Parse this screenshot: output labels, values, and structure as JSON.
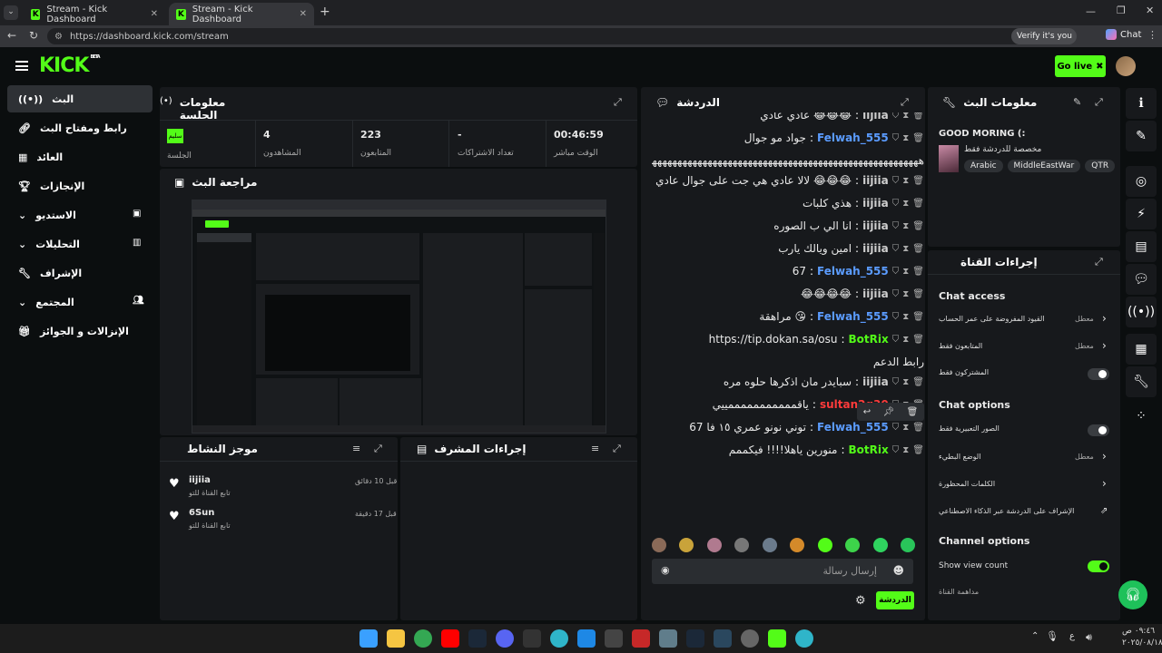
{
  "browser": {
    "tabs": [
      {
        "title": "Stream - Kick Dashboard"
      },
      {
        "title": "Stream - Kick Dashboard"
      }
    ],
    "url": "https://dashboard.kick.com/stream",
    "verify_label": "Verify it's you",
    "chat_label": "Chat"
  },
  "header": {
    "logo": "KICK",
    "logo_sup": "BETA",
    "go_live": "Go live"
  },
  "sidebar": {
    "items": [
      {
        "label": "البث"
      },
      {
        "label": "رابط ومفتاح البث"
      },
      {
        "label": "العائد"
      },
      {
        "label": "الإنجازات"
      },
      {
        "label": "الاستديو"
      },
      {
        "label": "التحليلات"
      },
      {
        "label": "الإشراف"
      },
      {
        "label": "المجتمع"
      },
      {
        "label": "الإنزالات و الجوائز"
      }
    ]
  },
  "session": {
    "title": "معلومات الجلسة",
    "live_badge": "(•)",
    "stats": [
      {
        "value": "00:46:59",
        "label": "الوقت مباشر"
      },
      {
        "value": "-",
        "label": "تعداد الاشتراكات"
      },
      {
        "value": "223",
        "label": "المتابعون"
      },
      {
        "value": "4",
        "label": "المشاهدون"
      }
    ],
    "session_badge": "سليم",
    "session_label": "الجلسة"
  },
  "preview": {
    "title": "مراجعة البث"
  },
  "activity": {
    "title": "موجز النشاط",
    "items": [
      {
        "user": "iijiia",
        "text": "تابع القناة للتو",
        "time": "قبل 10 دقائق"
      },
      {
        "user": "6Sun",
        "text": "تابع القناة للتو",
        "time": "قبل 17 دقيقة"
      }
    ]
  },
  "mod_actions": {
    "title": "إجراءات المشرف"
  },
  "chat": {
    "title": "الدردشة",
    "messages": [
      {
        "user": "iijiia",
        "text": "عادي عادي 😂😂😂",
        "color": "#cfcfcf"
      },
      {
        "user": "Felwah_555",
        "text": "جواد مو جوال",
        "color": "#5b9cff"
      },
      {
        "user": "",
        "text": "ههههههههههههههههههههههههههههههههههههههههههههههههههههههههه",
        "color": "#cfcfcf"
      },
      {
        "user": "iijiia",
        "text": "لالا عادي هي جت على جوال عادي احمد ربي 😂😂😂",
        "color": "#cfcfcf"
      },
      {
        "user": "iijiia",
        "text": "هذي كلبات",
        "color": "#cfcfcf"
      },
      {
        "user": "iijiia",
        "text": "انا الي ب الصوره",
        "color": "#cfcfcf"
      },
      {
        "user": "iijiia",
        "text": "امين ويالك يارب",
        "color": "#cfcfcf"
      },
      {
        "user": "Felwah_555",
        "text": "67",
        "color": "#5b9cff"
      },
      {
        "user": "iijiia",
        "text": "😂😂😂😂",
        "color": "#cfcfcf"
      },
      {
        "user": "Felwah_555",
        "text": "مراهقة 😘",
        "color": "#5b9cff"
      },
      {
        "user": "BotRix",
        "text": "https://tip.dokan.sa/osu",
        "color": "#53fc18"
      },
      {
        "user": "",
        "text": "رابط الدعم",
        "color": "#cfcfcf"
      },
      {
        "user": "iijiia",
        "text": "سبايدر مان اذكرها حلوه مره",
        "color": "#cfcfcf"
      },
      {
        "user": "sultan2q30",
        "text": "ياقمممممممممممييي",
        "color": "#ff3b3b"
      },
      {
        "user": "Felwah_555",
        "text": "توني نونو عمري ١٥ فا 67",
        "color": "#5b9cff"
      },
      {
        "user": "BotRix",
        "text": "منورين ياهلا!!!! فيكممم",
        "color": "#53fc18"
      }
    ],
    "placeholder": "إرسال رسالة",
    "send_label": "الدردشة"
  },
  "stream_info": {
    "title": "معلومات البث",
    "stream_title": "GOOD MORING (:",
    "category": "مخصصة للدردشة فقط",
    "tags": [
      "Arabic",
      "MiddleEastWar",
      "QTR"
    ]
  },
  "channel_actions": {
    "title": "إجراءات القناة",
    "chat_access_heading": "Chat access",
    "chat_access": [
      {
        "label": "القيود المفروضة على عمر الحساب",
        "value": "معطل"
      },
      {
        "label": "المتابعون فقط",
        "value": "معطل"
      },
      {
        "label": "المشتركون فقط",
        "value": ""
      }
    ],
    "chat_options_heading": "Chat options",
    "chat_options": [
      {
        "label": "الصور التعبيرية فقط",
        "value": ""
      },
      {
        "label": "الوضع البطيء",
        "value": "معطل"
      },
      {
        "label": "الكلمات المحظورة",
        "value": ""
      },
      {
        "label": "الإشراف على الدردشة عبر الذكاء الاصطناعي",
        "value": ""
      }
    ],
    "channel_options_heading": "Channel options",
    "show_view_count": "Show view count",
    "more": "مداهمة القناة"
  },
  "taskbar": {
    "time": "٠٩:٤٦ ص",
    "date": "٢٠٢٥/٠٨/١٨",
    "lang": "ع"
  }
}
